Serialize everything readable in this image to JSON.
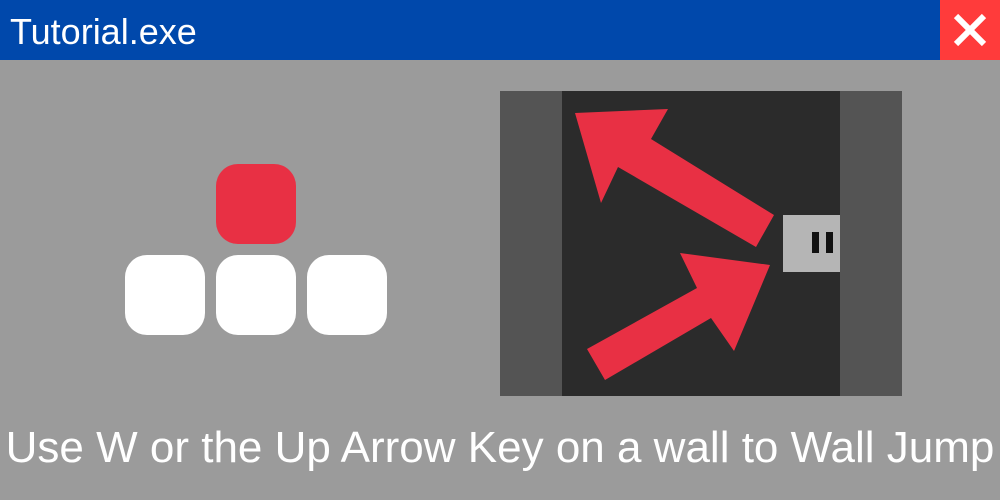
{
  "window": {
    "title": "Tutorial.exe",
    "close_icon": "close-icon"
  },
  "tutorial": {
    "caption": "Use W or the Up Arrow Key on a wall to Wall Jump",
    "highlighted_key": "up",
    "keys": [
      "up",
      "left",
      "down",
      "right"
    ],
    "illustration": {
      "description_icons": [
        "wall-jump-arrow-icon",
        "wall-jump-arrow-icon",
        "player-icon"
      ]
    }
  },
  "colors": {
    "titlebar": "#0048ab",
    "close": "#ff3b3b",
    "background": "#9b9b9b",
    "highlight": "#e83044",
    "key": "#ffffff",
    "wall": "#545454",
    "shaft": "#2b2b2b",
    "player": "#b5b5b5"
  }
}
